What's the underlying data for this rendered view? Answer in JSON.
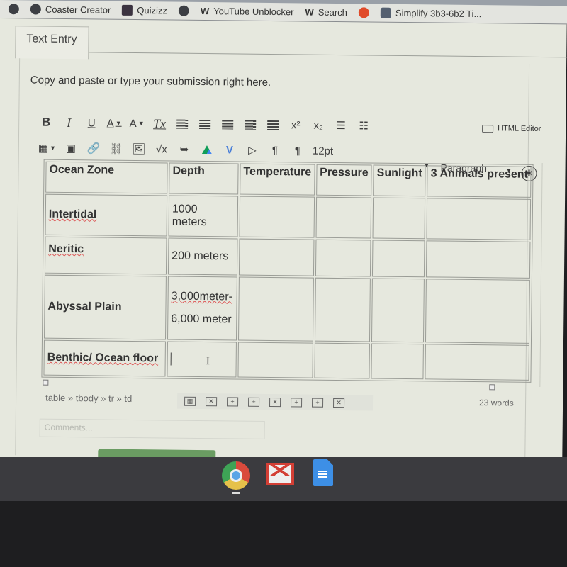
{
  "browser": {
    "url_fragment": "2481033",
    "bookmarks": [
      {
        "icon": "globe-icon",
        "label": ""
      },
      {
        "icon": "globe-icon",
        "label": "Coaster Creator"
      },
      {
        "icon": "quizizz-icon",
        "label": "Quizizz"
      },
      {
        "icon": "globe-icon",
        "label": ""
      },
      {
        "icon": "weebly-icon",
        "label": "YouTube Unblocker"
      },
      {
        "icon": "weebly-icon",
        "label": "Search"
      },
      {
        "icon": "sun-icon",
        "label": ""
      },
      {
        "icon": "bear-icon",
        "label": "Simplify 3b3-6b2 Ti..."
      }
    ]
  },
  "tab": {
    "label": "Text Entry"
  },
  "instructions": "Copy and paste or type your submission right here.",
  "toolbar": {
    "row1": [
      {
        "name": "bold",
        "icon": "bold-icon",
        "glyph": "B"
      },
      {
        "name": "italic",
        "icon": "italic-icon",
        "glyph": "I"
      },
      {
        "name": "underline",
        "icon": "underline-icon",
        "glyph": "U"
      },
      {
        "name": "font-color",
        "icon": "font-color-icon",
        "glyph": "A"
      },
      {
        "name": "background-color",
        "icon": "highlight-icon",
        "glyph": "A"
      },
      {
        "name": "clear-formatting",
        "icon": "clear-format-icon",
        "glyph": "Tx"
      },
      {
        "name": "align-left",
        "icon": "align-left-icon"
      },
      {
        "name": "align-center",
        "icon": "align-center-icon"
      },
      {
        "name": "align-right",
        "icon": "align-right-icon"
      },
      {
        "name": "outdent",
        "icon": "outdent-icon"
      },
      {
        "name": "indent",
        "icon": "indent-icon"
      },
      {
        "name": "superscript",
        "icon": "superscript-icon",
        "glyph": "x²"
      },
      {
        "name": "subscript",
        "icon": "subscript-icon",
        "glyph": "x₂"
      },
      {
        "name": "bullet-list",
        "icon": "bullet-list-icon",
        "glyph": "☰"
      },
      {
        "name": "numbered-list",
        "icon": "numbered-list-icon",
        "glyph": "☷"
      }
    ],
    "row2": [
      {
        "name": "table",
        "icon": "table-icon",
        "glyph": "▦"
      },
      {
        "name": "media",
        "icon": "media-icon",
        "glyph": "▣"
      },
      {
        "name": "link",
        "icon": "link-icon",
        "glyph": "🔗"
      },
      {
        "name": "unlink",
        "icon": "unlink-icon",
        "glyph": "⛓"
      },
      {
        "name": "image",
        "icon": "image-icon",
        "glyph": "🖼"
      },
      {
        "name": "equation",
        "icon": "equation-icon",
        "glyph": "√x"
      },
      {
        "name": "lti-apps",
        "icon": "lti-icon",
        "glyph": "➥"
      },
      {
        "name": "google-drive",
        "icon": "google-drive-icon"
      },
      {
        "name": "vimeo",
        "icon": "vimeo-icon",
        "glyph": "V"
      },
      {
        "name": "embed-video",
        "icon": "embed-video-icon",
        "glyph": "▷"
      },
      {
        "name": "ltr",
        "icon": "ltr-paragraph-icon",
        "glyph": "¶"
      },
      {
        "name": "rtl",
        "icon": "rtl-paragraph-icon",
        "glyph": "¶"
      }
    ],
    "font_size": "12pt",
    "paragraph_format": "Paragraph",
    "html_editor_label": "HTML Editor",
    "accessibility_glyph": "✱"
  },
  "table": {
    "headers": [
      "Ocean Zone",
      "Depth",
      "Temperature",
      "Pressure",
      "Sunlight",
      "3 Animals present"
    ],
    "rows": [
      {
        "zone": "Intertidal",
        "depth": [
          "1000 meters"
        ],
        "temperature": "",
        "pressure": "",
        "sunlight": "",
        "animals": ""
      },
      {
        "zone": "Neritic",
        "depth": [
          "200 meters"
        ],
        "temperature": "",
        "pressure": "",
        "sunlight": "",
        "animals": ""
      },
      {
        "zone": "Abyssal Plain",
        "depth": [
          "3,000meter-",
          "6,000 meter"
        ],
        "temperature": "",
        "pressure": "",
        "sunlight": "",
        "animals": ""
      },
      {
        "zone": "Benthic/  Ocean floor",
        "depth": [
          ""
        ],
        "temperature": "",
        "pressure": "",
        "sunlight": "",
        "animals": ""
      }
    ]
  },
  "statusbar": {
    "path": "table » tbody » tr » td",
    "word_count": "23 words"
  },
  "comments": {
    "placeholder": "Comments..."
  },
  "shelf": [
    {
      "icon": "chrome-icon",
      "label": "Chrome"
    },
    {
      "icon": "gmail-icon",
      "label": "Gmail"
    },
    {
      "icon": "docs-icon",
      "label": "Docs"
    }
  ]
}
